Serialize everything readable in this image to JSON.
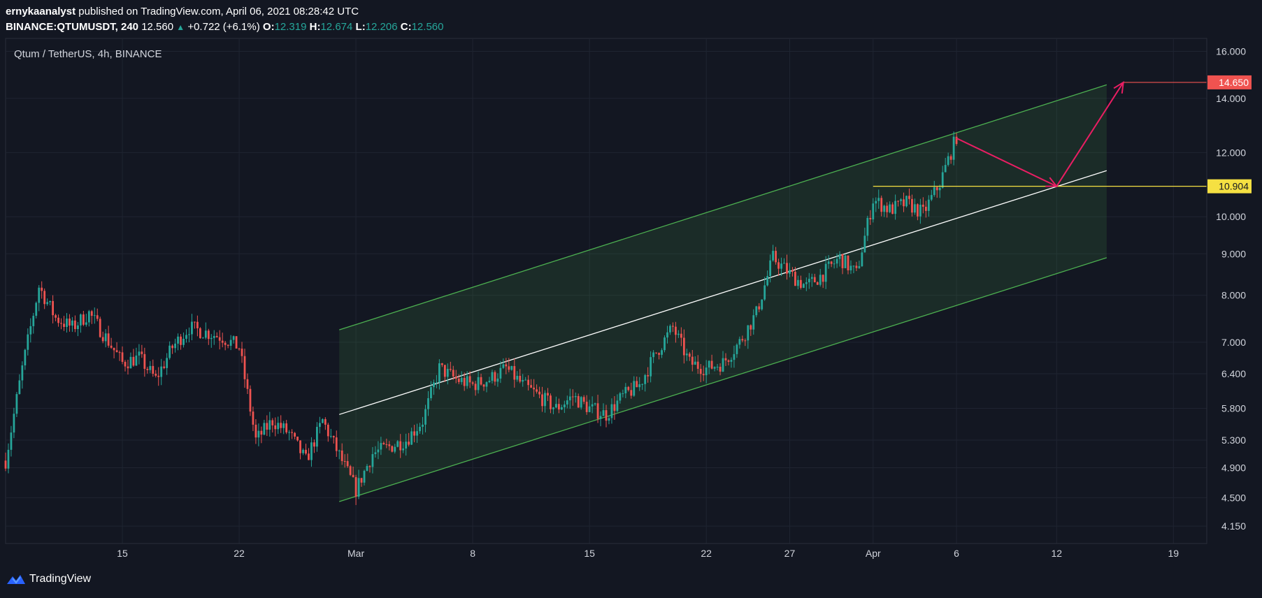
{
  "header": {
    "author": "ernykaanalyst",
    "published_text": "published on TradingView.com, April 06, 2021 08:28:42 UTC",
    "symbol": "BINANCE:QTUMUSDT, 240",
    "last": "12.560",
    "change": "+0.722 (+6.1%)",
    "open_label": "O:",
    "open": "12.319",
    "high_label": "H:",
    "high": "12.674",
    "low_label": "L:",
    "low": "12.206",
    "close_label": "C:",
    "close": "12.560"
  },
  "footer": {
    "brand": "TradingView",
    "logo_icon": "tradingview-logo-icon"
  },
  "colors": {
    "background": "#131722",
    "grid": "#1f2431",
    "text": "#d1d4dc",
    "up": "#26a69a",
    "down": "#ef5350",
    "channel_line": "#4caf50",
    "channel_fill": "rgba(76,175,80,0.14)",
    "midline": "#ffffff",
    "target_line": "#ef5350",
    "support_line": "#f5e042",
    "arrow": "#e91e63"
  },
  "chart_data": {
    "type": "candlestick",
    "title": "Qtum / TetherUS, 4h, BINANCE",
    "scale": "log",
    "ylim": [
      3.95,
      16.6
    ],
    "xlim": [
      "2021-02-08",
      "2021-04-21"
    ],
    "yticks": [
      4.15,
      4.5,
      4.9,
      5.3,
      5.8,
      6.4,
      7.0,
      8.0,
      9.0,
      10.0,
      12.0,
      14.0,
      16.0
    ],
    "ytick_labels": [
      "4.150",
      "4.500",
      "4.900",
      "5.300",
      "5.800",
      "6.400",
      "7.000",
      "8.000",
      "9.000",
      "10.000",
      "12.000",
      "14.000",
      "16.000"
    ],
    "xticks": [
      {
        "date": "2021-02-15",
        "label": "15"
      },
      {
        "date": "2021-02-22",
        "label": "22"
      },
      {
        "date": "2021-03-01",
        "label": "Mar"
      },
      {
        "date": "2021-03-08",
        "label": "8"
      },
      {
        "date": "2021-03-15",
        "label": "15"
      },
      {
        "date": "2021-03-22",
        "label": "22"
      },
      {
        "date": "2021-03-27",
        "label": "27"
      },
      {
        "date": "2021-04-01",
        "label": "Apr"
      },
      {
        "date": "2021-04-06",
        "label": "6"
      },
      {
        "date": "2021-04-12",
        "label": "12"
      },
      {
        "date": "2021-04-19",
        "label": "19"
      }
    ],
    "price_path": [
      [
        "2021-02-08",
        5.0
      ],
      [
        "2021-02-09",
        6.5
      ],
      [
        "2021-02-10",
        8.2
      ],
      [
        "2021-02-11",
        7.5
      ],
      [
        "2021-02-12",
        7.3
      ],
      [
        "2021-02-13",
        7.6
      ],
      [
        "2021-02-14",
        7.1
      ],
      [
        "2021-02-15",
        6.6
      ],
      [
        "2021-02-16",
        6.7
      ],
      [
        "2021-02-17",
        6.3
      ],
      [
        "2021-02-18",
        6.9
      ],
      [
        "2021-02-19",
        7.3
      ],
      [
        "2021-02-20",
        7.2
      ],
      [
        "2021-02-21",
        7.1
      ],
      [
        "2021-02-22",
        6.9
      ],
      [
        "2021-02-23",
        5.3
      ],
      [
        "2021-02-24",
        5.6
      ],
      [
        "2021-02-25",
        5.4
      ],
      [
        "2021-02-26",
        5.0
      ],
      [
        "2021-02-27",
        5.6
      ],
      [
        "2021-03-01",
        4.6
      ],
      [
        "2021-03-02",
        5.1
      ],
      [
        "2021-03-03",
        5.2
      ],
      [
        "2021-03-04",
        5.3
      ],
      [
        "2021-03-05",
        5.6
      ],
      [
        "2021-03-06",
        6.5
      ],
      [
        "2021-03-07",
        6.3
      ],
      [
        "2021-03-08",
        6.2
      ],
      [
        "2021-03-09",
        6.3
      ],
      [
        "2021-03-10",
        6.5
      ],
      [
        "2021-03-11",
        6.2
      ],
      [
        "2021-03-12",
        6.0
      ],
      [
        "2021-03-13",
        5.8
      ],
      [
        "2021-03-14",
        6.0
      ],
      [
        "2021-03-15",
        5.8
      ],
      [
        "2021-03-16",
        5.7
      ],
      [
        "2021-03-17",
        6.0
      ],
      [
        "2021-03-18",
        6.2
      ],
      [
        "2021-03-19",
        6.8
      ],
      [
        "2021-03-20",
        7.3
      ],
      [
        "2021-03-21",
        6.6
      ],
      [
        "2021-03-22",
        6.5
      ],
      [
        "2021-03-23",
        6.6
      ],
      [
        "2021-03-24",
        7.0
      ],
      [
        "2021-03-25",
        7.6
      ],
      [
        "2021-03-26",
        8.9
      ],
      [
        "2021-03-27",
        8.5
      ],
      [
        "2021-03-28",
        8.2
      ],
      [
        "2021-03-29",
        8.5
      ],
      [
        "2021-03-30",
        8.9
      ],
      [
        "2021-03-31",
        8.5
      ],
      [
        "2021-04-01",
        10.5
      ],
      [
        "2021-04-02",
        10.2
      ],
      [
        "2021-04-03",
        10.4
      ],
      [
        "2021-04-04",
        10.1
      ],
      [
        "2021-04-05",
        11.0
      ],
      [
        "2021-04-06",
        12.56
      ]
    ],
    "drawings": {
      "channel": {
        "start": "2021-02-28",
        "end": "2021-04-15",
        "upper": [
          7.25,
          14.55
        ],
        "mid": [
          5.7,
          11.4
        ],
        "lower": [
          4.45,
          8.9
        ]
      },
      "target": {
        "value": 14.65,
        "label": "14.650",
        "start": "2021-04-16"
      },
      "support": {
        "value": 10.904,
        "label": "10.904",
        "start": "2021-04-01"
      },
      "projection": [
        [
          "2021-04-06",
          12.5
        ],
        [
          "2021-04-12",
          10.904
        ],
        [
          "2021-04-16",
          14.65
        ]
      ]
    }
  }
}
